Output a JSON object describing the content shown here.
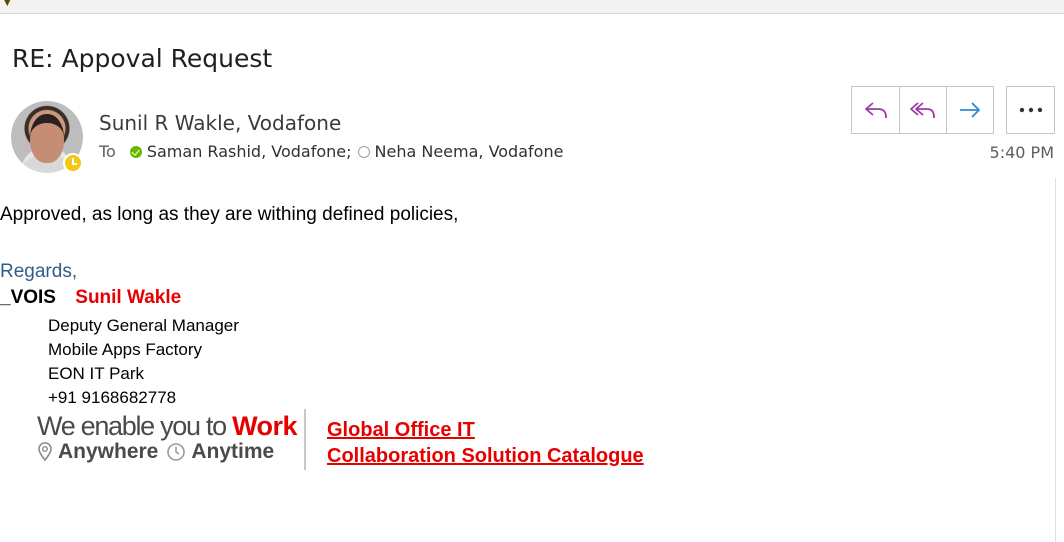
{
  "email": {
    "subject": "RE: Appoval Request",
    "sender": "Sunil R Wakle, Vodafone",
    "to_label": "To",
    "recipients": [
      {
        "name": "Saman Rashid, Vodafone;",
        "status": "available"
      },
      {
        "name": "Neha Neema, Vodafone",
        "status": "offline"
      }
    ],
    "time": "5:40 PM",
    "body": "Approved, as long as they are withing defined policies,",
    "regards": "Regards,"
  },
  "actions": {
    "icons": [
      "reply-icon",
      "reply-all-icon",
      "forward-icon",
      "more-icon"
    ],
    "colors": {
      "reply": "#9b3aa8",
      "forward": "#2b88d8"
    }
  },
  "signature": {
    "company": "_VOIS",
    "name": "Sunil Wakle",
    "details": [
      "Deputy General Manager",
      "Mobile Apps Factory",
      "EON IT Park",
      "+91 9168682778"
    ],
    "banner": {
      "enable_text": "We enable you to ",
      "work": "Work",
      "anywhere": "Anywhere",
      "anytime": "Anytime",
      "link1": "Global Office IT",
      "link2": "Collaboration Solution Catalogue"
    },
    "accent_color": "#e60000"
  }
}
